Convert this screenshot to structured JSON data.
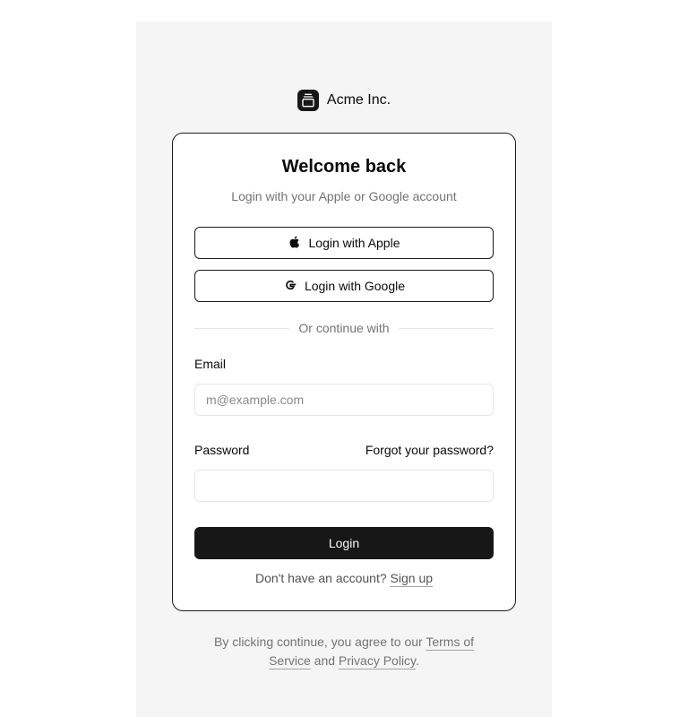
{
  "brand": {
    "name": "Acme Inc.",
    "logo_icon": "gallery-vertical-end-icon"
  },
  "card": {
    "title": "Welcome back",
    "subtitle": "Login with your Apple or Google account",
    "apple_button": {
      "label": "Login with Apple",
      "icon": "apple-icon"
    },
    "google_button": {
      "label": "Login with Google",
      "icon": "google-icon"
    },
    "divider_text": "Or continue with",
    "email": {
      "label": "Email",
      "placeholder": "m@example.com",
      "value": ""
    },
    "password": {
      "label": "Password",
      "value": "",
      "forgot_link": "Forgot your password?"
    },
    "login_button": "Login",
    "signup": {
      "prompt": "Don't have an account?",
      "link": "Sign up"
    }
  },
  "footer": {
    "prefix": "By clicking continue, you agree to our",
    "terms_link": "Terms of Service",
    "conjunction": "and",
    "privacy_link": "Privacy Policy",
    "suffix": "."
  },
  "colors": {
    "background": "#f5f5f5",
    "primary": "#171717",
    "muted_text": "#737373",
    "border": "#e5e5e5"
  }
}
